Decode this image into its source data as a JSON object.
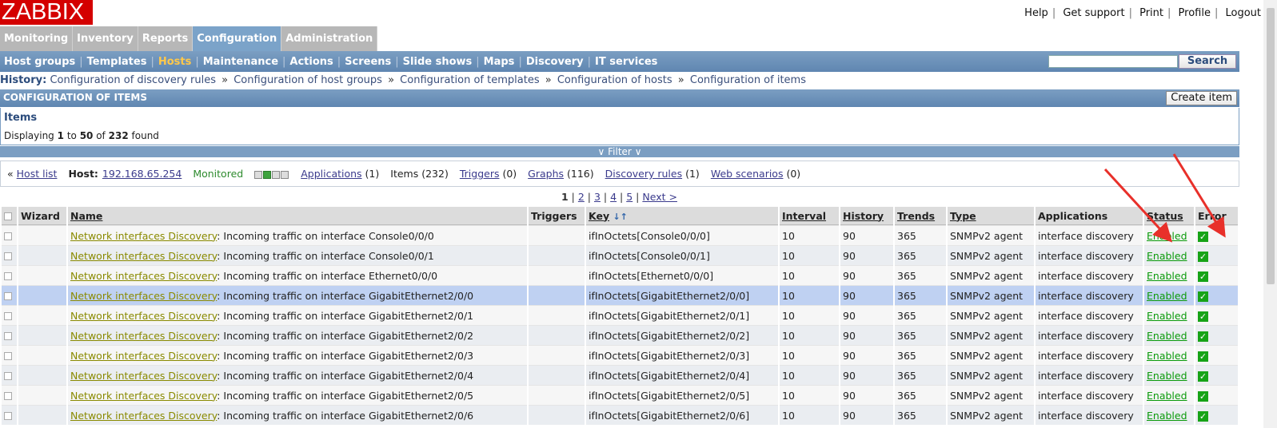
{
  "app": {
    "logo": "ZABBIX"
  },
  "top_links": [
    "Help",
    "Get support",
    "Print",
    "Profile",
    "Logout"
  ],
  "main_menu": [
    {
      "label": "Monitoring",
      "active": false
    },
    {
      "label": "Inventory",
      "active": false
    },
    {
      "label": "Reports",
      "active": false
    },
    {
      "label": "Configuration",
      "active": true
    },
    {
      "label": "Administration",
      "active": false
    }
  ],
  "sub_menu": [
    {
      "label": "Host groups"
    },
    {
      "label": "Templates"
    },
    {
      "label": "Hosts",
      "active": true
    },
    {
      "label": "Maintenance"
    },
    {
      "label": "Actions"
    },
    {
      "label": "Screens"
    },
    {
      "label": "Slide shows"
    },
    {
      "label": "Maps"
    },
    {
      "label": "Discovery"
    },
    {
      "label": "IT services"
    }
  ],
  "search": {
    "button": "Search",
    "value": ""
  },
  "history": {
    "label": "History:",
    "items": [
      "Configuration of discovery rules",
      "Configuration of host groups",
      "Configuration of templates",
      "Configuration of hosts",
      "Configuration of items"
    ],
    "sep": "»"
  },
  "header": {
    "title": "CONFIGURATION OF ITEMS",
    "create_button": "Create item"
  },
  "items_box": {
    "title": "Items",
    "display_prefix": "Displaying",
    "from": "1",
    "to_word": "to",
    "to": "50",
    "of_word": "of",
    "total": "232",
    "found": "found"
  },
  "filter": {
    "label": "Filter"
  },
  "hostbar": {
    "back": "«",
    "host_list": "Host list",
    "host_label": "Host:",
    "host": "192.168.65.254",
    "status": "Monitored",
    "applications": "Applications",
    "applications_count": "(1)",
    "items": "Items",
    "items_count": "(232)",
    "triggers": "Triggers",
    "triggers_count": "(0)",
    "graphs": "Graphs",
    "graphs_count": "(116)",
    "discovery": "Discovery rules",
    "discovery_count": "(1)",
    "web": "Web scenarios",
    "web_count": "(0)"
  },
  "pager": {
    "pages": [
      "1",
      "2",
      "3",
      "4",
      "5"
    ],
    "current": "1",
    "next": "Next >"
  },
  "columns": {
    "wizard": "Wizard",
    "name": "Name",
    "triggers": "Triggers",
    "key": "Key",
    "interval": "Interval",
    "history": "History",
    "trends": "Trends",
    "type": "Type",
    "applications": "Applications",
    "status": "Status",
    "error": "Error"
  },
  "rows": [
    {
      "prefix": "Network interfaces Discovery",
      "name": ": Incoming traffic on interface Console0/0/0",
      "key": "ifInOctets[Console0/0/0]",
      "interval": "10",
      "history": "90",
      "trends": "365",
      "type": "SNMPv2 agent",
      "app": "interface discovery",
      "status": "Enabled"
    },
    {
      "prefix": "Network interfaces Discovery",
      "name": ": Incoming traffic on interface Console0/0/1",
      "key": "ifInOctets[Console0/0/1]",
      "interval": "10",
      "history": "90",
      "trends": "365",
      "type": "SNMPv2 agent",
      "app": "interface discovery",
      "status": "Enabled"
    },
    {
      "prefix": "Network interfaces Discovery",
      "name": ": Incoming traffic on interface Ethernet0/0/0",
      "key": "ifInOctets[Ethernet0/0/0]",
      "interval": "10",
      "history": "90",
      "trends": "365",
      "type": "SNMPv2 agent",
      "app": "interface discovery",
      "status": "Enabled"
    },
    {
      "prefix": "Network interfaces Discovery",
      "name": ": Incoming traffic on interface GigabitEthernet2/0/0",
      "key": "ifInOctets[GigabitEthernet2/0/0]",
      "interval": "10",
      "history": "90",
      "trends": "365",
      "type": "SNMPv2 agent",
      "app": "interface discovery",
      "status": "Enabled"
    },
    {
      "prefix": "Network interfaces Discovery",
      "name": ": Incoming traffic on interface GigabitEthernet2/0/1",
      "key": "ifInOctets[GigabitEthernet2/0/1]",
      "interval": "10",
      "history": "90",
      "trends": "365",
      "type": "SNMPv2 agent",
      "app": "interface discovery",
      "status": "Enabled"
    },
    {
      "prefix": "Network interfaces Discovery",
      "name": ": Incoming traffic on interface GigabitEthernet2/0/2",
      "key": "ifInOctets[GigabitEthernet2/0/2]",
      "interval": "10",
      "history": "90",
      "trends": "365",
      "type": "SNMPv2 agent",
      "app": "interface discovery",
      "status": "Enabled"
    },
    {
      "prefix": "Network interfaces Discovery",
      "name": ": Incoming traffic on interface GigabitEthernet2/0/3",
      "key": "ifInOctets[GigabitEthernet2/0/3]",
      "interval": "10",
      "history": "90",
      "trends": "365",
      "type": "SNMPv2 agent",
      "app": "interface discovery",
      "status": "Enabled"
    },
    {
      "prefix": "Network interfaces Discovery",
      "name": ": Incoming traffic on interface GigabitEthernet2/0/4",
      "key": "ifInOctets[GigabitEthernet2/0/4]",
      "interval": "10",
      "history": "90",
      "trends": "365",
      "type": "SNMPv2 agent",
      "app": "interface discovery",
      "status": "Enabled"
    },
    {
      "prefix": "Network interfaces Discovery",
      "name": ": Incoming traffic on interface GigabitEthernet2/0/5",
      "key": "ifInOctets[GigabitEthernet2/0/5]",
      "interval": "10",
      "history": "90",
      "trends": "365",
      "type": "SNMPv2 agent",
      "app": "interface discovery",
      "status": "Enabled"
    },
    {
      "prefix": "Network interfaces Discovery",
      "name": ": Incoming traffic on interface GigabitEthernet2/0/6",
      "key": "ifInOctets[GigabitEthernet2/0/6]",
      "interval": "10",
      "history": "90",
      "trends": "365",
      "type": "SNMPv2 agent",
      "app": "interface discovery",
      "status": "Enabled"
    }
  ],
  "colors": {
    "logo_red": "#d40000",
    "menu_active": "#7ba3c9",
    "submenu_active": "#ffc84a",
    "link_olive": "#8a8a00",
    "enabled_green": "#0a9a0a",
    "arrow_red": "#e8302a"
  }
}
